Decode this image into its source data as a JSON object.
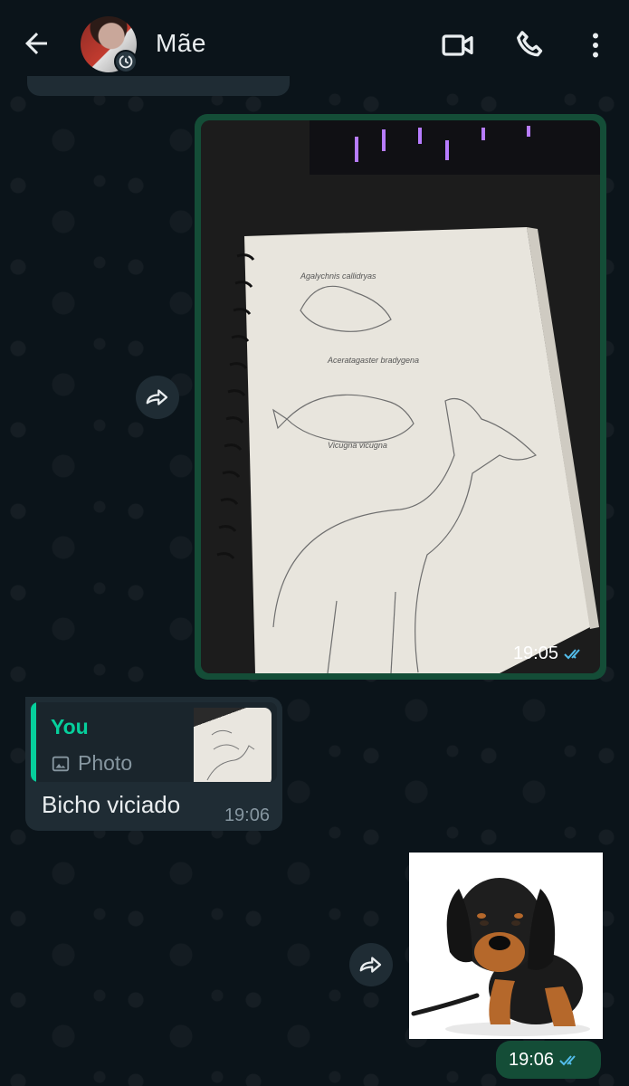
{
  "header": {
    "contact_name": "Mãe",
    "back_icon": "arrow-left-icon",
    "video_icon": "video-camera-icon",
    "call_icon": "phone-icon",
    "menu_icon": "more-vertical-icon"
  },
  "messages": [
    {
      "type": "image",
      "direction": "outgoing",
      "time": "19:05",
      "status": "read"
    },
    {
      "type": "text",
      "direction": "incoming",
      "reply_to": {
        "author": "You",
        "kind": "Photo"
      },
      "text": "Bicho viciado",
      "time": "19:06"
    },
    {
      "type": "image",
      "direction": "outgoing",
      "time": "19:06",
      "status": "read"
    }
  ],
  "colors": {
    "background": "#0b141a",
    "outgoing_bubble": "#144d37",
    "incoming_bubble": "#1f2c34",
    "accent": "#06cf9c",
    "read_ticks": "#53bdeb"
  }
}
